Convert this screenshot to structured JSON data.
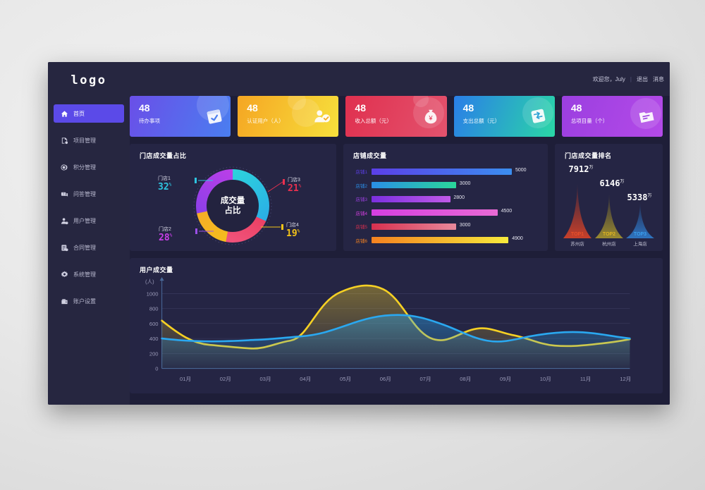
{
  "brand": {
    "logo": "logo"
  },
  "topbar": {
    "welcome": "欢迎您，July",
    "separator": "|",
    "logout": "退出",
    "messages": "消息"
  },
  "sidebar": {
    "items": [
      {
        "label": "首页",
        "icon": "home-icon",
        "active": true
      },
      {
        "label": "项目管理",
        "icon": "project-icon",
        "active": false
      },
      {
        "label": "积分管理",
        "icon": "points-icon",
        "active": false
      },
      {
        "label": "问答管理",
        "icon": "qa-icon",
        "active": false
      },
      {
        "label": "用户管理",
        "icon": "user-icon",
        "active": false
      },
      {
        "label": "合同管理",
        "icon": "contract-icon",
        "active": false
      },
      {
        "label": "系统管理",
        "icon": "gear-icon",
        "active": false
      },
      {
        "label": "账户设置",
        "icon": "wallet-icon",
        "active": false
      }
    ]
  },
  "cards": [
    {
      "value": "48",
      "label": "待办事项",
      "icon": "calendar-check-icon",
      "color": "#6a4fe8"
    },
    {
      "value": "48",
      "label": "认证用户（人）",
      "icon": "user-check-icon",
      "color": "#f5a623"
    },
    {
      "value": "48",
      "label": "收入总额（元）",
      "icon": "money-bag-icon",
      "color": "#e0304f"
    },
    {
      "value": "48",
      "label": "支出总额（元）",
      "icon": "transfer-icon",
      "color": "#2a7ee8"
    },
    {
      "value": "48",
      "label": "总项目量（个）",
      "icon": "folder-icon",
      "color": "#9b3fe0"
    }
  ],
  "panels": {
    "donut_title": "门店成交量占比",
    "bar_title": "店铺成交量",
    "rank_title": "门店成交量排名",
    "line_title": "用户成交量"
  },
  "chart_data": [
    {
      "type": "pie",
      "title": "门店成交量占比",
      "center_label": [
        "成交量",
        "占比"
      ],
      "unit": "%",
      "categories": [
        "门店1",
        "门店2",
        "门店3",
        "门店4"
      ],
      "values": [
        32,
        28,
        21,
        19
      ],
      "colors": [
        "#2ec4e0",
        "#9b4fe8",
        "#e8304f",
        "#f5c518"
      ],
      "legend": "around"
    },
    {
      "type": "bar",
      "title": "店铺成交量",
      "orientation": "horizontal",
      "categories": [
        "店铺1",
        "店铺2",
        "店铺3",
        "店铺4",
        "店铺5",
        "店铺6"
      ],
      "values": [
        5000,
        3000,
        2800,
        4500,
        3000,
        4900
      ],
      "xlabel": "",
      "ylabel": "",
      "xlim": [
        0,
        5400
      ],
      "grid": false,
      "bar_colors": [
        {
          "from": "#5b3fe8",
          "to": "#3b8ef0"
        },
        {
          "from": "#2a8ee8",
          "to": "#2ad79a"
        },
        {
          "from": "#7b2fe0",
          "to": "#c05ae8"
        },
        {
          "from": "#d43fe0",
          "to": "#e86ad4"
        },
        {
          "from": "#d8304f",
          "to": "#e8899b"
        },
        {
          "from": "#f58220",
          "to": "#f7ea3c"
        }
      ]
    },
    {
      "type": "bar",
      "title": "门店成交量排名",
      "shape": "triangle",
      "categories": [
        "苏州店",
        "杭州店",
        "上海店"
      ],
      "ranks": [
        "TOP1",
        "TOP2",
        "TOP3"
      ],
      "values": [
        7912,
        6146,
        5338
      ],
      "unit": "万",
      "colors": [
        "#b33a2a",
        "#8a7a2a",
        "#2a6ab3"
      ],
      "rank_colors": [
        "#e8502a",
        "#e0b520",
        "#3aa0f0"
      ]
    },
    {
      "type": "area",
      "title": "用户成交量",
      "ylabel": "(人)",
      "ylim": [
        0,
        1200
      ],
      "yticks": [
        0,
        200,
        400,
        600,
        800,
        1000
      ],
      "grid": true,
      "categories": [
        "01月",
        "02月",
        "03月",
        "04月",
        "05月",
        "06月",
        "07月",
        "08月",
        "09月",
        "10月",
        "11月",
        "12月"
      ],
      "series": [
        {
          "name": "series-yellow",
          "color": "#f5d024",
          "values": [
            640,
            330,
            360,
            960,
            1130,
            700,
            470,
            540,
            430,
            370,
            375,
            420
          ]
        },
        {
          "name": "series-blue",
          "color": "#2aa8f0",
          "values": [
            400,
            370,
            365,
            390,
            470,
            600,
            660,
            560,
            400,
            440,
            465,
            405
          ]
        }
      ]
    }
  ]
}
